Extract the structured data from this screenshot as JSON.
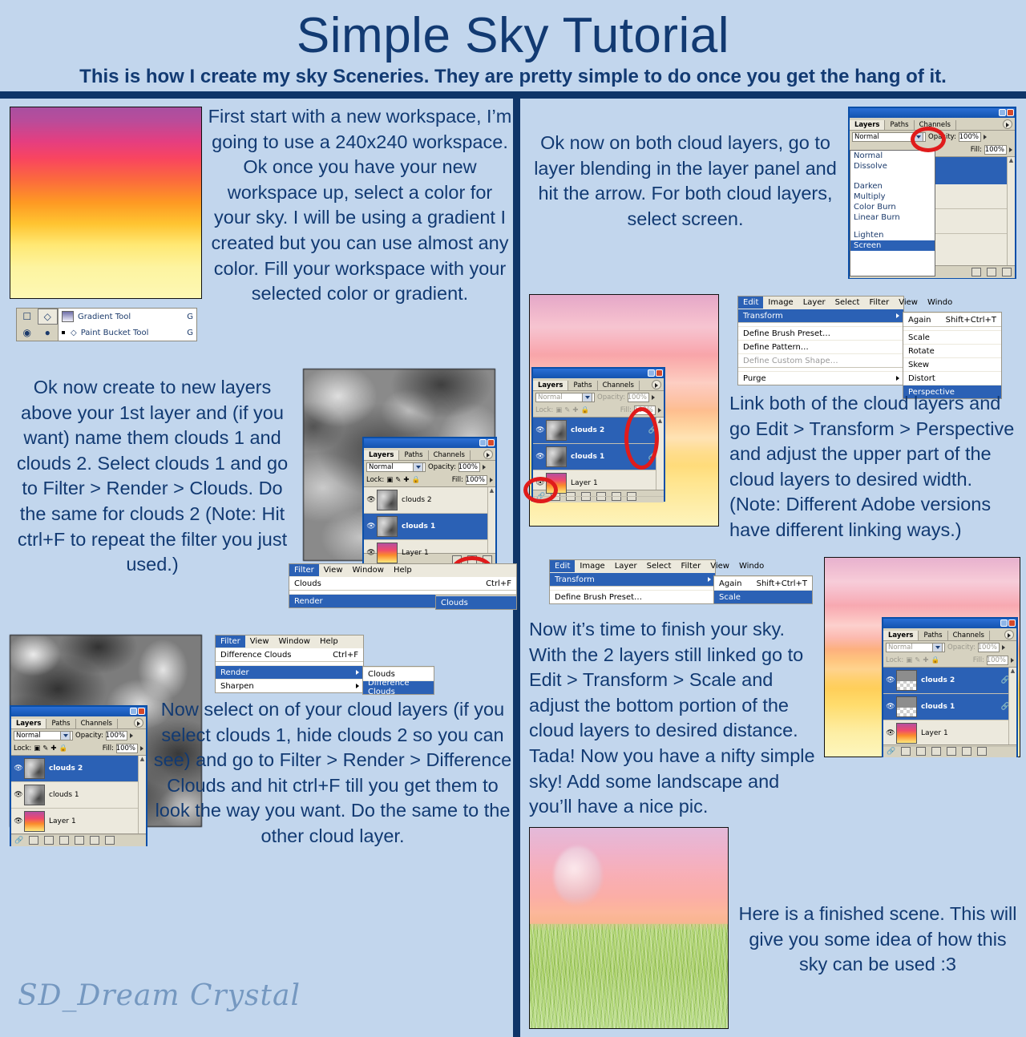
{
  "header": {
    "title": "Simple Sky Tutorial",
    "subtitle": "This is how I create my sky Sceneries. They are pretty simple to do once you get the hang of it."
  },
  "steps": {
    "step1_text": "First start with a new workspace, I’m going to use a 240x240 workspace. Ok once you have your new workspace up, select a color for your sky. I will be using a gradient I created but you can use almost any color. Fill your workspace with your selected color or gradient.",
    "step2_text": "Ok now create to new layers above your 1st layer and (if you want) name them clouds 1 and clouds 2. Select clouds 1 and go to Filter > Render > Clouds. Do the same for clouds 2 (Note: Hit ctrl+F to repeat the filter you just used.)",
    "step3_text": "Now select on of your cloud layers (if you select clouds 1, hide clouds 2 so you can see) and go to Filter > Render > Difference Clouds and hit ctrl+F till you get them to look the way you want. Do the same to the other cloud layer.",
    "step4_text": "Ok now on both cloud layers, go to layer blending in the layer panel and hit the arrow. For both cloud layers, select screen.",
    "step5_text": "Link both of the cloud layers and go Edit > Transform > Perspective and adjust the upper part of the cloud layers to desired width. (Note: Different Adobe versions have different linking ways.)",
    "step6_text": "Now it’s time to finish your sky. With the 2 layers still linked go to Edit > Transform > Scale and adjust the bottom portion of the cloud layers to desired distance. Tada! Now you have a nifty simple sky! Add some landscape and you’ll have a nice pic.",
    "step7_text": "Here is a finished scene. This will give you some idea of how this sky can be used :3"
  },
  "tool_flyout": {
    "items": [
      {
        "label": "Gradient Tool",
        "shortcut": "G"
      },
      {
        "label": "Paint Bucket Tool",
        "shortcut": "G"
      }
    ]
  },
  "layers_panel_1": {
    "tabs": [
      "Layers",
      "Paths",
      "Channels"
    ],
    "blend_mode": "Normal",
    "opacity_label": "Opacity:",
    "opacity_value": "100%",
    "lock_label": "Lock:",
    "fill_label": "Fill:",
    "fill_value": "100%",
    "layers": [
      {
        "name": "clouds 2",
        "selected": false
      },
      {
        "name": "clouds 1",
        "selected": true
      },
      {
        "name": "Layer 1",
        "selected": false
      }
    ]
  },
  "layers_panel_2": {
    "tabs": [
      "Layers",
      "Paths",
      "Channels"
    ],
    "blend_mode": "Normal",
    "opacity_label": "Opacity:",
    "opacity_value": "100%",
    "lock_label": "Lock:",
    "fill_label": "Fill:",
    "fill_value": "100%",
    "layers": [
      {
        "name": "clouds 2",
        "selected": true
      },
      {
        "name": "clouds 1",
        "selected": false
      },
      {
        "name": "Layer 1",
        "selected": false
      }
    ]
  },
  "layers_panel_3": {
    "tabs": [
      "Layers",
      "Paths",
      "Channels"
    ],
    "blend_mode": "Normal",
    "opacity_label": "Opacity:",
    "opacity_value": "100%",
    "lock_label": "Lock:",
    "fill_label": "Fill:",
    "fill_value": "100%",
    "layers": [
      {
        "name": "clouds 2",
        "selected": true,
        "linked": true
      },
      {
        "name": "clouds 1",
        "selected": true,
        "linked": true
      },
      {
        "name": "Layer 1",
        "selected": false,
        "linked": false
      }
    ]
  },
  "layers_panel_4": {
    "tabs": [
      "Layers",
      "Paths",
      "Channels"
    ],
    "blend_mode": "Normal",
    "opacity_label": "Opacity:",
    "opacity_value": "100%",
    "lock_label": "Lock:",
    "fill_label": "Fill:",
    "fill_value": "100%",
    "layers": [
      {
        "name": "clouds 2",
        "selected": true,
        "linked": true
      },
      {
        "name": "clouds 1",
        "selected": true,
        "linked": true
      },
      {
        "name": "Layer 1",
        "selected": false,
        "linked": false
      }
    ]
  },
  "blend_dropdown": {
    "selected": "Normal",
    "options": [
      "Normal",
      "Dissolve",
      "Darken",
      "Multiply",
      "Color Burn",
      "Linear Burn",
      "Lighten",
      "Screen"
    ],
    "highlighted": "Screen",
    "opacity_label": "Opacity:",
    "opacity_value": "100%",
    "fill_label": "Fill:",
    "fill_value": "100%",
    "tabs": [
      "Layers",
      "Paths",
      "Channels"
    ]
  },
  "filter_menu_clouds": {
    "menubar": [
      "Filter",
      "View",
      "Window",
      "Help"
    ],
    "active": "Filter",
    "items": [
      {
        "label": "Clouds",
        "shortcut": "Ctrl+F"
      },
      {
        "label": "Render",
        "shortcut": "",
        "submenu": true,
        "highlighted": true
      }
    ],
    "submenu": [
      {
        "label": "Clouds",
        "highlighted": true
      }
    ]
  },
  "filter_menu_difference": {
    "menubar": [
      "Filter",
      "View",
      "Window",
      "Help"
    ],
    "active": "Filter",
    "items": [
      {
        "label": "Difference Clouds",
        "shortcut": "Ctrl+F"
      },
      {
        "label": "Render",
        "shortcut": "",
        "submenu": true,
        "highlighted": true
      },
      {
        "label": "Sharpen",
        "shortcut": "",
        "submenu": true
      }
    ],
    "submenu": [
      {
        "label": "Clouds",
        "highlighted": false
      },
      {
        "label": "Difference Clouds",
        "highlighted": true
      }
    ]
  },
  "edit_menu_perspective": {
    "menubar": [
      "Edit",
      "Image",
      "Layer",
      "Select",
      "Filter",
      "View",
      "Windo"
    ],
    "active": "Edit",
    "items": [
      {
        "label": "Transform",
        "highlighted": true,
        "submenu": true
      },
      {
        "label": "Define Brush Preset…"
      },
      {
        "label": "Define Pattern…"
      },
      {
        "label": "Define Custom Shape…",
        "disabled": true
      },
      {
        "label": "Purge",
        "submenu": true
      }
    ],
    "submenu": [
      {
        "label": "Again",
        "shortcut": "Shift+Ctrl+T"
      },
      {
        "label": "Scale"
      },
      {
        "label": "Rotate"
      },
      {
        "label": "Skew"
      },
      {
        "label": "Distort"
      },
      {
        "label": "Perspective",
        "highlighted": true
      }
    ]
  },
  "edit_menu_scale": {
    "menubar": [
      "Edit",
      "Image",
      "Layer",
      "Select",
      "Filter",
      "View",
      "Windo"
    ],
    "active": "Edit",
    "items": [
      {
        "label": "Transform",
        "highlighted": true,
        "submenu": true
      },
      {
        "label": "Define Brush Preset…"
      }
    ],
    "submenu": [
      {
        "label": "Again",
        "shortcut": "Shift+Ctrl+T"
      },
      {
        "label": "Scale",
        "highlighted": true
      }
    ]
  },
  "signature": "SD_Dream Crystal",
  "colors": {
    "background": "#c2d6ed",
    "rule": "#0f3568",
    "text": "#123a72",
    "highlight_ring": "#e01b1b",
    "ps_title": "#1453ae",
    "ps_selected_row": "#2b61b5"
  }
}
